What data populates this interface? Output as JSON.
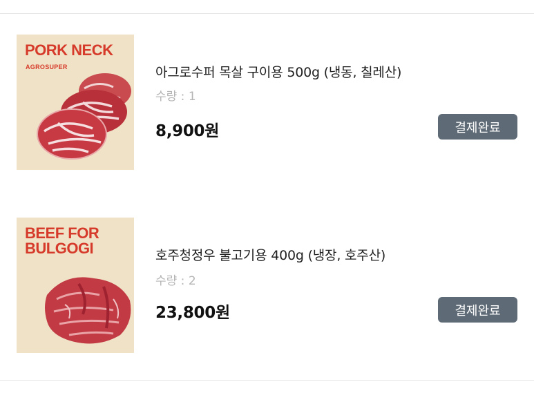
{
  "orders": [
    {
      "thumbnail_title": "PORK NECK",
      "thumbnail_subtitle": "AGROSUPER",
      "name": "아그로수퍼 목살 구이용 500g (냉동, 칠레산)",
      "quantity": "수량 : 1",
      "price": "8,900원",
      "status": "결제완료"
    },
    {
      "thumbnail_title": "BEEF FOR\nBULGOGI",
      "thumbnail_subtitle": "",
      "name": "호주청정우 불고기용 400g (냉장, 호주산)",
      "quantity": "수량 : 2",
      "price": "23,800원",
      "status": "결제완료"
    }
  ],
  "colors": {
    "status_button": "#5e6b76",
    "thumbnail_bg": "#f0e2c6",
    "thumbnail_text": "#d63a2a",
    "quantity_text": "#b4b4b4"
  }
}
